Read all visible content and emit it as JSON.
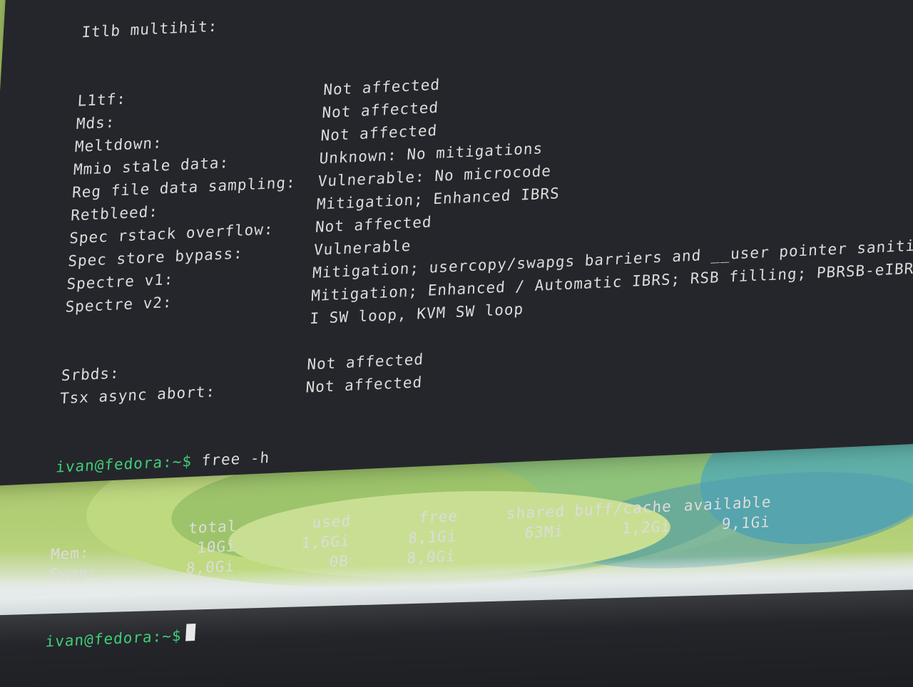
{
  "terminal": {
    "top_partial_line": "Itlb multihit:",
    "vulnerabilities": [
      {
        "label": "L1tf:",
        "value": "Not affected"
      },
      {
        "label": "Mds:",
        "value": "Not affected"
      },
      {
        "label": "Meltdown:",
        "value": "Not affected"
      },
      {
        "label": "Mmio stale data:",
        "value": "Unknown: No mitigations"
      },
      {
        "label": "Reg file data sampling:",
        "value": "Vulnerable: No microcode"
      },
      {
        "label": "Retbleed:",
        "value": "Mitigation; Enhanced IBRS"
      },
      {
        "label": "Spec rstack overflow:",
        "value": "Not affected"
      },
      {
        "label": "Spec store bypass:",
        "value": "Vulnerable"
      },
      {
        "label": "Spectre v1:",
        "value": "Mitigation; usercopy/swapgs barriers and __user pointer sanitizati"
      },
      {
        "label": "Spectre v2:",
        "value": "Mitigation; Enhanced / Automatic IBRS; RSB filling; PBRSB-eIBRS SW"
      },
      {
        "label": "",
        "value": "I SW loop, KVM SW loop"
      },
      {
        "label": "Srbds:",
        "value": "Not affected"
      },
      {
        "label": "Tsx async abort:",
        "value": "Not affected"
      }
    ],
    "prompt": "ivan@fedora:~$",
    "command": "free -h",
    "free_table": {
      "headers": [
        "",
        "total",
        "used",
        "free",
        "shared",
        "buff/cache",
        "available"
      ],
      "rows": [
        [
          "Mem:",
          "10Gi",
          "1,6Gi",
          "8,1Gi",
          "63Mi",
          "1,2Gi",
          "9,1Gi"
        ],
        [
          "Swap:",
          "8,0Gi",
          "0B",
          "8,0Gi",
          "",
          "",
          ""
        ]
      ]
    },
    "final_prompt": "ivan@fedora:~$"
  },
  "colors": {
    "terminal_bg": "#25262b",
    "prompt": "#3fcf78",
    "text": "#dcdcdc",
    "wallpaper": "#a8c86a"
  }
}
